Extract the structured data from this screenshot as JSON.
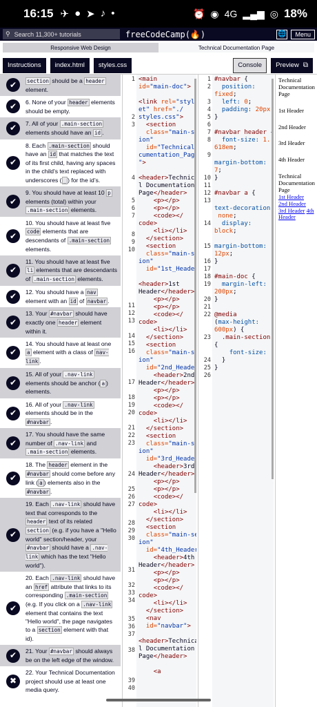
{
  "status_bar": {
    "time": "16:15",
    "network": "4G",
    "battery": "18%"
  },
  "fcc": {
    "search_placeholder": "Search 11,300+ tutorials",
    "brand": "freeCodeCamp(🔥)",
    "menu_label": "Menu"
  },
  "breadcrumb": {
    "left": "Responsive Web Design",
    "right": "Technical Documentation Page"
  },
  "tabs": {
    "instructions": "Instructions",
    "index": "index.html",
    "styles": "styles.css",
    "console": "Console",
    "preview": "Preview"
  },
  "tests": [
    {
      "status": "pass",
      "html": "<code>section</code> should be a <code>header</code> element."
    },
    {
      "status": "pass",
      "html": "6. None of your <code>header</code> elements should be empty."
    },
    {
      "status": "pass",
      "html": "7. All of your <code>.main-section</code> elements should have an <code>id</code>."
    },
    {
      "status": "pass",
      "html": "8. Each <code>.main-section</code> should have an <code>id</code> that matches the text of its first child, having any spaces in the child's text replaced with underscores (<code>_</code>) for the id’s."
    },
    {
      "status": "pass",
      "html": "9. You should have at least 10 <code>p</code> elements (total) within your <code>.main-section</code> elements."
    },
    {
      "status": "pass",
      "html": "10. You should have at least five <code>code</code> elements that are descendants of <code>.main-section</code> elements."
    },
    {
      "status": "pass",
      "html": "11. You should have at least five <code>li</code> elements that are descendants of <code>.main-section</code> elements."
    },
    {
      "status": "pass",
      "html": "12. You should have a <code>nav</code> element with an <code>id</code> of <code>navbar</code>."
    },
    {
      "status": "pass",
      "html": "13. Your <code>#navbar</code> should have exactly one <code>header</code> element within it."
    },
    {
      "status": "pass",
      "html": "14. You should have at least one <code>a</code> element with a class of <code>nav-link</code>."
    },
    {
      "status": "pass",
      "html": "15. All of your <code>.nav-link</code> elements should be anchor (<code>a</code>) elements."
    },
    {
      "status": "pass",
      "html": "16. All of your <code>.nav-link</code> elements should be in the <code>#navbar</code>."
    },
    {
      "status": "pass",
      "html": "17. You should have the same number of <code>.nav-link</code> and <code>.main-section</code> elements."
    },
    {
      "status": "pass",
      "html": "18. The <code>header</code> element in the <code>#navbar</code> should come before any link (<code>a</code>) elements also in the <code>#navbar</code>."
    },
    {
      "status": "pass",
      "html": "19. Each <code>.nav-link</code> should have text that corresponds to the <code>header</code> text of its related <code>section</code> (e.g. if you have a \"Hello world\" section/header, your <code>#navbar</code> should have a <code>.nav-link</code> which has the text \"Hello world\")."
    },
    {
      "status": "pass",
      "html": "20. Each <code>.nav-link</code> should have an <code>href</code> attribute that links to its corresponding <code>.main-section</code> (e.g. If you click on a <code>.nav-link</code> element that contains the text \"Hello world\", the page navigates to a <code>section</code> element with that id)."
    },
    {
      "status": "pass",
      "html": "21. Your <code>#navbar</code> should always be on the left edge of the window."
    },
    {
      "status": "fail",
      "html": "22. Your Technical Documentation project should use at least one media query."
    }
  ],
  "preview": {
    "title": "Technical Documentation Page",
    "sections": [
      "1st Header",
      "2nd Header",
      "3rd Header",
      "4th Header"
    ],
    "nav_header": "Technical Documentation Page",
    "nav_links": [
      "1st Header",
      "2nd Header",
      "3rd Header",
      "4th Header"
    ]
  }
}
